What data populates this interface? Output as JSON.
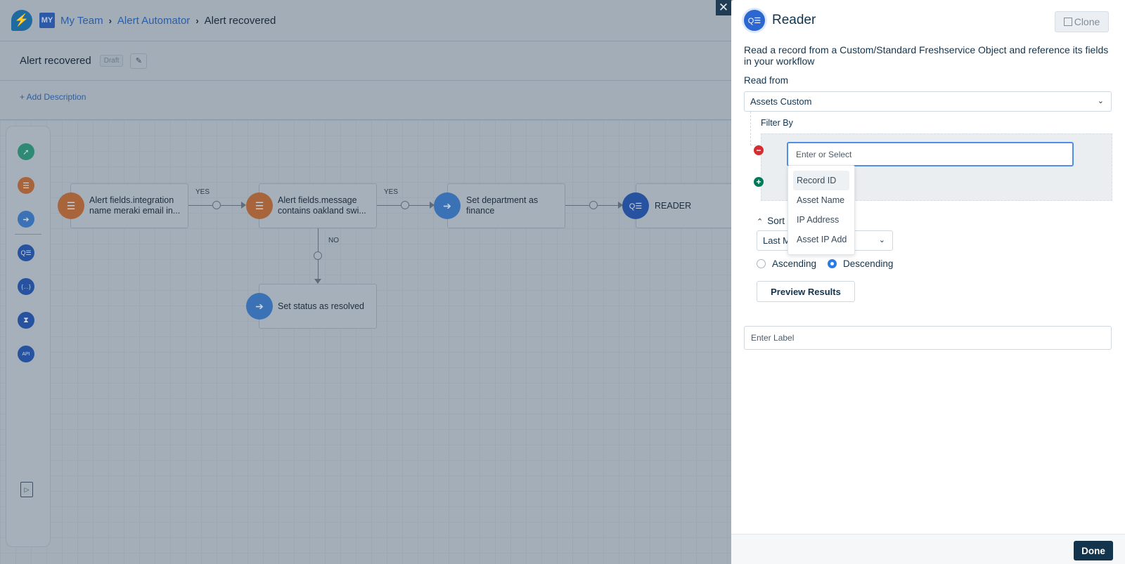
{
  "header": {
    "logo_icon": "lightning-icon",
    "workspace_badge": "MY",
    "breadcrumbs": [
      "My Team",
      "Alert Automator",
      "Alert recovered"
    ],
    "separator": "›"
  },
  "workflow": {
    "title": "Alert recovered",
    "status_badge": "Draft",
    "edit_icon": "pencil-icon",
    "add_description": "+ Add Description"
  },
  "palette": {
    "items": [
      {
        "name": "event-icon",
        "glyph": "➚"
      },
      {
        "name": "condition-icon",
        "glyph": "☰"
      },
      {
        "name": "action-icon",
        "glyph": "➔"
      },
      {
        "name": "reader-icon",
        "glyph": "Q☰"
      },
      {
        "name": "expression-icon",
        "glyph": "{…}"
      },
      {
        "name": "timer-icon",
        "glyph": "⧗"
      },
      {
        "name": "web-request-icon",
        "glyph": "API"
      }
    ],
    "docs_icon": "▷"
  },
  "canvas": {
    "nodes": [
      {
        "type": "condition",
        "text": "Alert fields.integration name meraki email in..."
      },
      {
        "type": "condition",
        "text": "Alert fields.message contains oakland swi..."
      },
      {
        "type": "action",
        "text": "Set department as finance"
      },
      {
        "type": "reader",
        "text": "READER"
      },
      {
        "type": "action",
        "text": "Set status as resolved"
      }
    ],
    "edge_labels": {
      "yes1": "YES",
      "yes2": "YES",
      "no": "NO"
    }
  },
  "close_glyph": "✕",
  "panel": {
    "title": "Reader",
    "clone_label": "Clone",
    "description": "Read a record from a Custom/Standard Freshservice Object and reference its fields in your workflow",
    "read_from_label": "Read from",
    "read_from_value": "Assets Custom",
    "filter_by_label": "Filter By",
    "filter_input_placeholder": "Enter or Select",
    "filter_options": [
      "Record ID",
      "Asset Name",
      "IP Address",
      "Asset IP Add"
    ],
    "filter_options_active": "Record ID",
    "sort_label": "Sort",
    "sort_value": "Last Modified",
    "sort_visible_text": "Last M",
    "order_options": [
      {
        "label": "Ascending",
        "selected": false
      },
      {
        "label": "Descending",
        "selected": true
      }
    ],
    "preview_label": "Preview Results",
    "label_placeholder": "Enter Label",
    "done_label": "Done"
  },
  "colors": {
    "primary_dark": "#12344d",
    "focus_blue": "#4f8ee6",
    "remove_red": "#d72d30",
    "add_green": "#00795b",
    "condition_orange": "#a8643a",
    "action_blue": "#3b72b5",
    "reader_blue": "#2652a0"
  }
}
